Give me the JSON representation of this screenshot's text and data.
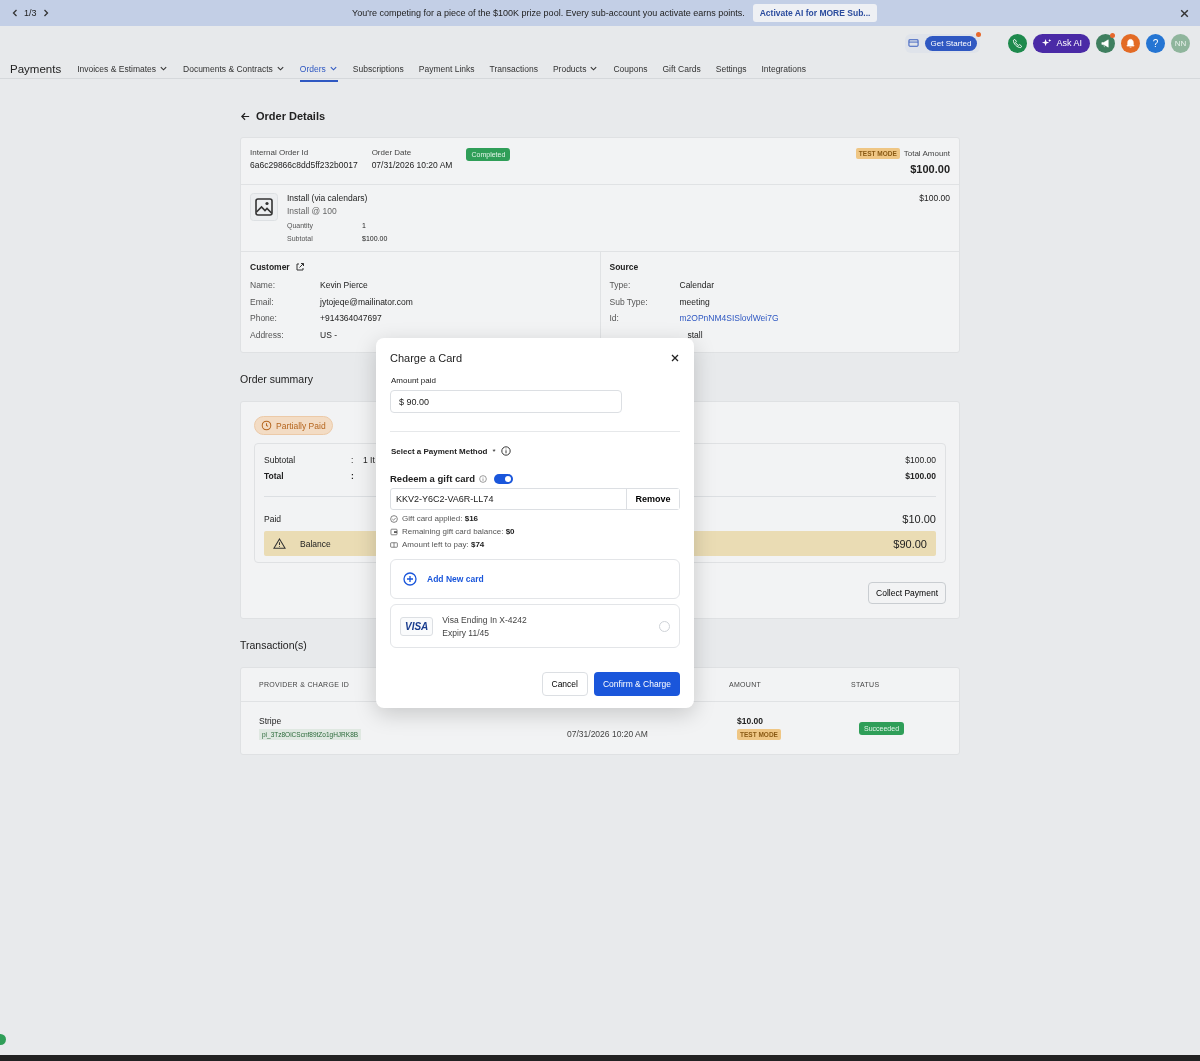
{
  "banner": {
    "pager": "1/3",
    "message": "You're competing for a piece of the $100K prize pool. Every sub-account you activate earns points.",
    "action": "Activate AI for MORE Sub..."
  },
  "topbar": {
    "get_started": "Get Started",
    "ask_ai": "Ask AI",
    "help": "?",
    "avatar": "NN"
  },
  "app_title": "Payments",
  "tabs": [
    {
      "label": "Invoices & Estimates",
      "dropdown": true,
      "selected": false
    },
    {
      "label": "Documents & Contracts",
      "dropdown": true,
      "selected": false
    },
    {
      "label": "Orders",
      "dropdown": true,
      "selected": true
    },
    {
      "label": "Subscriptions",
      "dropdown": false,
      "selected": false
    },
    {
      "label": "Payment Links",
      "dropdown": false,
      "selected": false
    },
    {
      "label": "Transactions",
      "dropdown": false,
      "selected": false
    },
    {
      "label": "Products",
      "dropdown": true,
      "selected": false
    },
    {
      "label": "Coupons",
      "dropdown": false,
      "selected": false
    },
    {
      "label": "Gift Cards",
      "dropdown": false,
      "selected": false
    },
    {
      "label": "Settings",
      "dropdown": false,
      "selected": false
    },
    {
      "label": "Integrations",
      "dropdown": false,
      "selected": false
    }
  ],
  "page_title": "Order Details",
  "order": {
    "id_label": "Internal Order Id",
    "id": "6a6c29866c8dd5ff232b0017",
    "date_label": "Order Date",
    "date": "07/31/2026 10:20 AM",
    "status": "Completed",
    "mode": "TEST MODE",
    "total_label": "Total Amount",
    "total": "$100.00"
  },
  "item": {
    "name": "Install (via calendars)",
    "variant": "Install @ 100",
    "price": "$100.00",
    "fields": [
      {
        "label": "Quantity",
        "value": "1"
      },
      {
        "label": "Subtotal",
        "value": "$100.00"
      }
    ]
  },
  "customer": {
    "title": "Customer",
    "rows": [
      {
        "label": "Name:",
        "value": "Kevin Pierce"
      },
      {
        "label": "Email:",
        "value": "jytojeqe@mailinator.com"
      },
      {
        "label": "Phone:",
        "value": "+914364047697"
      },
      {
        "label": "Address:",
        "value": "US -"
      }
    ]
  },
  "source": {
    "title": "Source",
    "rows": [
      {
        "label": "Type:",
        "value": "Calendar",
        "kind": "text"
      },
      {
        "label": "Sub Type:",
        "value": "meeting",
        "kind": "text"
      },
      {
        "label": "Id:",
        "value": "m2OPnNM4SISlovlWei7G",
        "kind": "link"
      }
    ],
    "covered_value": "stall"
  },
  "summary": {
    "title": "Order summary",
    "status": "Partially Paid",
    "subtotal_label": "Subtotal",
    "subtotal_colon": ":",
    "subtotal_items": "1 It",
    "subtotal": "$100.00",
    "total_label": "Total",
    "total_colon": ":",
    "total": "$100.00",
    "paid_label": "Paid",
    "paid": "$10.00",
    "balance_label": "Balance",
    "balance": "$90.00",
    "collect": "Collect Payment"
  },
  "transactions": {
    "title": "Transaction(s)",
    "columns": [
      "PROVIDER & CHARGE ID",
      "AMOUNT",
      "STATUS"
    ],
    "rows": [
      {
        "provider": "Stripe",
        "charge_id": "pi_3Tz8OiCScnf89tZo1gHJRK8B",
        "date": "07/31/2026 10:20 AM",
        "amount": "$10.00",
        "mode": "TEST MODE",
        "status": "Succeeded"
      }
    ]
  },
  "modal": {
    "title": "Charge a Card",
    "amount_label": "Amount paid",
    "amount": "$ 90.00",
    "method_label": "Select a Payment Method",
    "required": "*",
    "gift_label": "Redeem a gift card",
    "gift_on": true,
    "gift_code": "KKV2-Y6C2-VA6R-LL74",
    "remove": "Remove",
    "gift_notes": [
      {
        "kind": "check",
        "text": "Gift card applied: **$16**"
      },
      {
        "kind": "wallet",
        "text": "Remaining gift card balance: **$0**"
      },
      {
        "kind": "cash",
        "text": "Amount left to pay: **$74**"
      }
    ],
    "add_card": "Add New card",
    "cards": [
      {
        "brand": "VISA",
        "name": "Visa Ending In X-4242",
        "expiry": "Expiry 11/45",
        "selected": false
      }
    ],
    "cancel": "Cancel",
    "confirm": "Confirm & Charge"
  }
}
